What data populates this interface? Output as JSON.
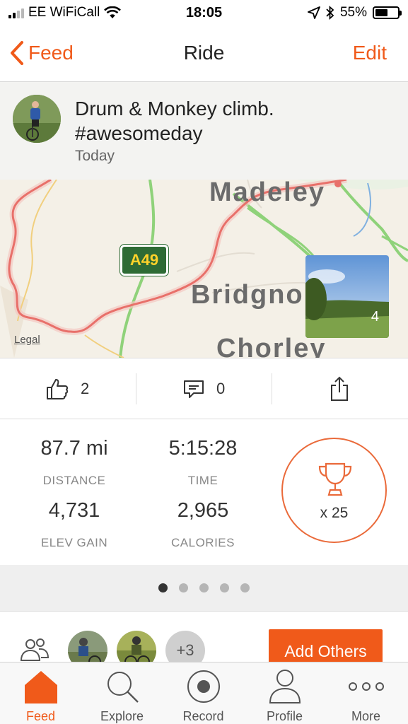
{
  "status_bar": {
    "carrier": "EE WiFiCall",
    "time": "18:05",
    "battery_percent": "55%",
    "battery_level": 0.55
  },
  "nav": {
    "back_label": "Feed",
    "title": "Ride",
    "edit_label": "Edit"
  },
  "activity": {
    "title": "Drum & Monkey climb. #awesomeday",
    "date": "Today"
  },
  "map": {
    "road_label": "A49",
    "places": [
      "Madeley",
      "Bridgno",
      "Chorley"
    ],
    "legal_label": "Legal",
    "photo_count": "4",
    "route_color": "#e8706a"
  },
  "social": {
    "kudos_count": "2",
    "comments_count": "0"
  },
  "stats": {
    "distance": {
      "value": "87.7 mi",
      "label": "DISTANCE"
    },
    "time": {
      "value": "5:15:28",
      "label": "TIME"
    },
    "elev_gain": {
      "value": "4,731",
      "label": "ELEV GAIN"
    },
    "calories": {
      "value": "2,965",
      "label": "CALORIES"
    },
    "trophies": "x 25"
  },
  "pager": {
    "pages": 5,
    "active": 0
  },
  "athletes": {
    "more_count": "+3",
    "add_others_label": "Add Others"
  },
  "tabs": [
    {
      "label": "Feed",
      "icon": "home-icon",
      "active": true
    },
    {
      "label": "Explore",
      "icon": "search-icon",
      "active": false
    },
    {
      "label": "Record",
      "icon": "record-icon",
      "active": false
    },
    {
      "label": "Profile",
      "icon": "profile-icon",
      "active": false
    },
    {
      "label": "More",
      "icon": "more-icon",
      "active": false
    }
  ],
  "colors": {
    "accent": "#f05a1a",
    "road_shield": "#2e6b35"
  }
}
